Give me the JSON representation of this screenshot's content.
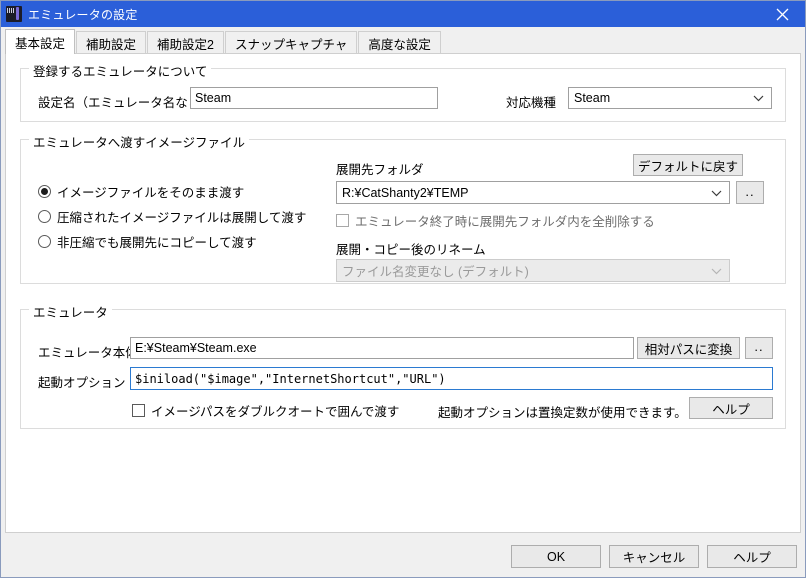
{
  "window": {
    "title": "エミュレータの設定",
    "icon": "emulator-cartridge-icon",
    "close_label": "×",
    "titlebar_color": "#2b5fd9"
  },
  "tabs": [
    {
      "label": "基本設定",
      "active": true
    },
    {
      "label": "補助設定",
      "active": false
    },
    {
      "label": "補助設定2",
      "active": false
    },
    {
      "label": "スナップキャプチャ",
      "active": false
    },
    {
      "label": "高度な設定",
      "active": false
    }
  ],
  "group_registration": {
    "title": "登録するエミュレータについて",
    "name_label": "設定名（エミュレータ名など）",
    "name_value": "Steam",
    "machine_label": "対応機種",
    "machine_value": "Steam"
  },
  "group_image": {
    "title": "エミュレータへ渡すイメージファイル",
    "radios": [
      {
        "label": "イメージファイルをそのまま渡す",
        "checked": true
      },
      {
        "label": "圧縮されたイメージファイルは展開して渡す",
        "checked": false
      },
      {
        "label": "非圧縮でも展開先にコピーして渡す",
        "checked": false
      }
    ],
    "dest_folder_label": "展開先フォルダ",
    "dest_folder_value": "R:¥CatShanty2¥TEMP",
    "default_button": "デフォルトに戻す",
    "browse_button": "..",
    "delete_on_exit_label": "エミュレータ終了時に展開先フォルダ内を全削除する",
    "delete_on_exit_checked": false,
    "rename_label": "展開・コピー後のリネーム",
    "rename_value": "ファイル名変更なし (デフォルト)",
    "rename_disabled": true
  },
  "group_emulator": {
    "title": "エミュレータ",
    "exe_label": "エミュレータ本体",
    "exe_value": "E:¥Steam¥Steam.exe",
    "relative_button": "相対パスに変換",
    "browse_button": "..",
    "options_label": "起動オプション",
    "options_value": "$iniload(\"$image\",\"InternetShortcut\",\"URL\")",
    "quote_label": "イメージパスをダブルクオートで囲んで渡す",
    "quote_checked": false,
    "hint_text": "起動オプションは置換定数が使用できます。",
    "help_button": "ヘルプ"
  },
  "footer": {
    "ok": "OK",
    "cancel": "キャンセル",
    "help": "ヘルプ"
  }
}
